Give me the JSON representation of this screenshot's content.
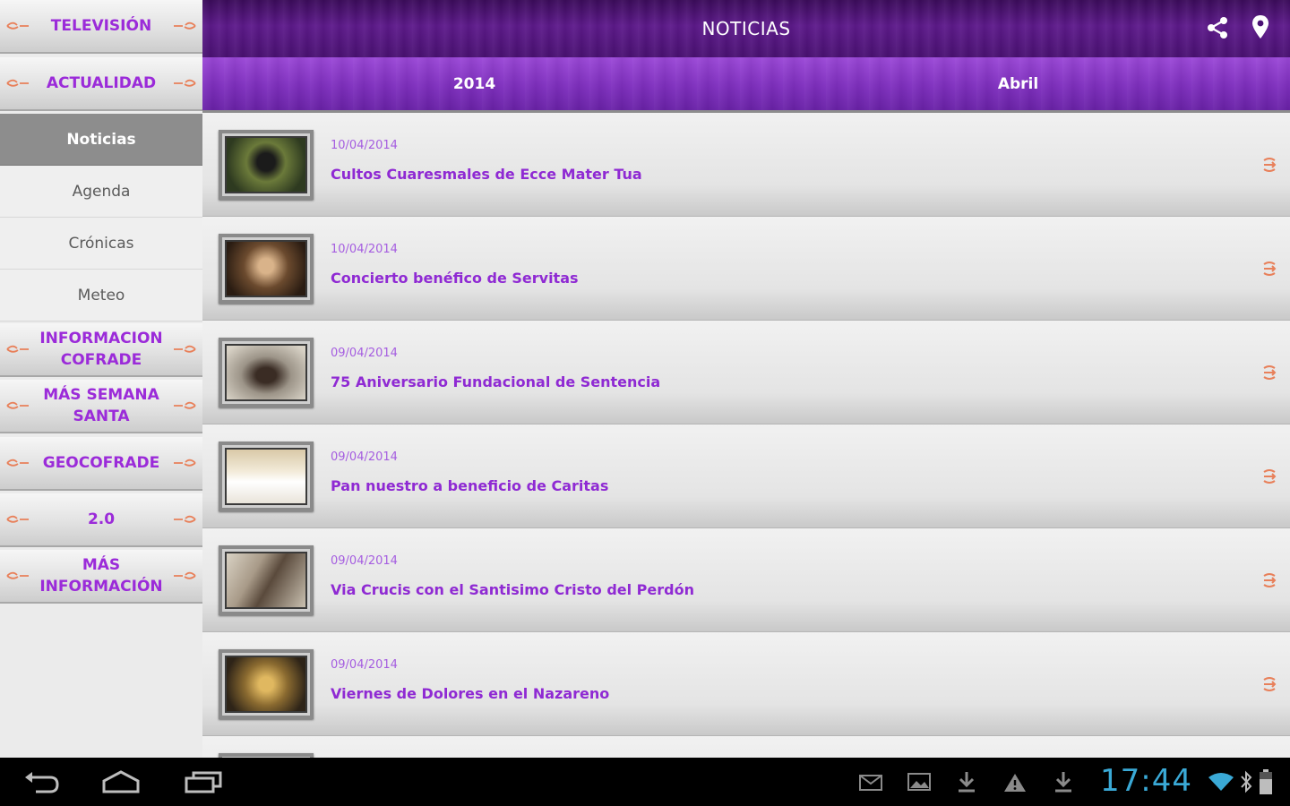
{
  "sidebar": {
    "sections": [
      {
        "label": "TELEVISIÓN"
      },
      {
        "label": "ACTUALIDAD"
      }
    ],
    "subitems": [
      {
        "label": "Noticias"
      },
      {
        "label": "Agenda"
      },
      {
        "label": "Crónicas"
      },
      {
        "label": "Meteo"
      }
    ],
    "more_sections": [
      {
        "label": "INFORMACION COFRADE"
      },
      {
        "label": "MÁS SEMANA SANTA"
      },
      {
        "label": "GEOCOFRADE"
      },
      {
        "label": "2.0"
      },
      {
        "label": "MÁS INFORMACIÓN"
      }
    ]
  },
  "header": {
    "title": "NOTICIAS",
    "share_icon": "share-icon",
    "location_icon": "location-pin-icon"
  },
  "filters": {
    "year": "2014",
    "month": "Abril"
  },
  "news": [
    {
      "date": "10/04/2014",
      "title": "Cultos Cuaresmales de Ecce Mater Tua"
    },
    {
      "date": "10/04/2014",
      "title": "Concierto benéfico de Servitas"
    },
    {
      "date": "09/04/2014",
      "title": "75 Aniversario Fundacional de Sentencia"
    },
    {
      "date": "09/04/2014",
      "title": "Pan nuestro a beneficio de Caritas"
    },
    {
      "date": "09/04/2014",
      "title": "Via Crucis con el Santisimo Cristo del Perdón"
    },
    {
      "date": "09/04/2014",
      "title": "Viernes de Dolores en el Nazareno"
    }
  ],
  "statusbar": {
    "time": "17:44"
  },
  "colors": {
    "accent": "#9b2bd9",
    "header": "#4a1173",
    "filterbar": "#7f2fbf",
    "ornament": "#e8805a",
    "clock": "#3aa9d6"
  }
}
